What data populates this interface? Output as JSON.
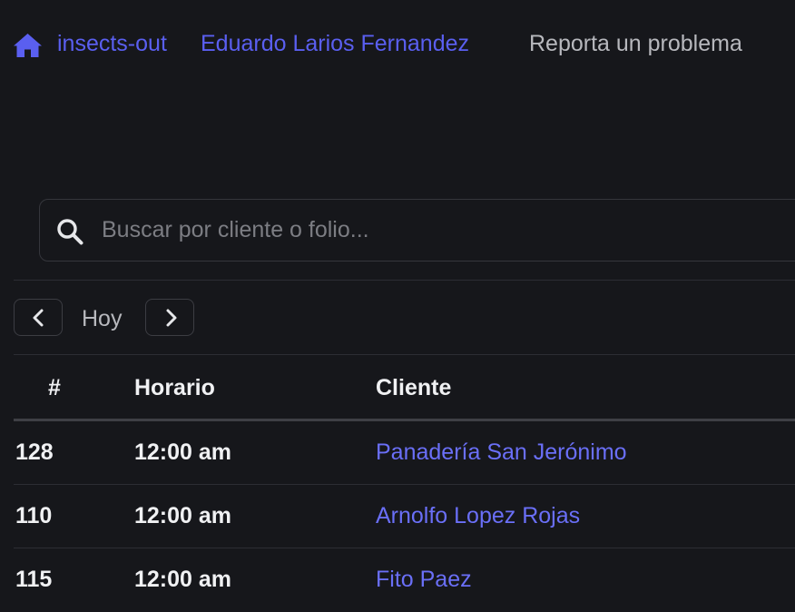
{
  "colors": {
    "background": "#16171b",
    "link": "#5a5ff0",
    "client_link": "#6a6ff7",
    "muted_text": "#b7b8bd",
    "border": "#35363c"
  },
  "nav": {
    "home_icon": "home-icon",
    "app_name": "insects-out",
    "user_name": "Eduardo Larios Fernandez",
    "report_label": "Reporta un problema"
  },
  "search": {
    "icon": "search-icon",
    "placeholder": "Buscar por cliente o folio...",
    "value": ""
  },
  "date_nav": {
    "prev_icon": "chevron-left-icon",
    "label": "Hoy",
    "next_icon": "chevron-right-icon"
  },
  "table": {
    "headers": {
      "number": "#",
      "time": "Horario",
      "client": "Cliente"
    },
    "rows": [
      {
        "number": "128",
        "time": "12:00 am",
        "client": "Panadería San Jerónimo"
      },
      {
        "number": "110",
        "time": "12:00 am",
        "client": "Arnolfo Lopez Rojas"
      },
      {
        "number": "115",
        "time": "12:00 am",
        "client": "Fito Paez"
      }
    ]
  }
}
